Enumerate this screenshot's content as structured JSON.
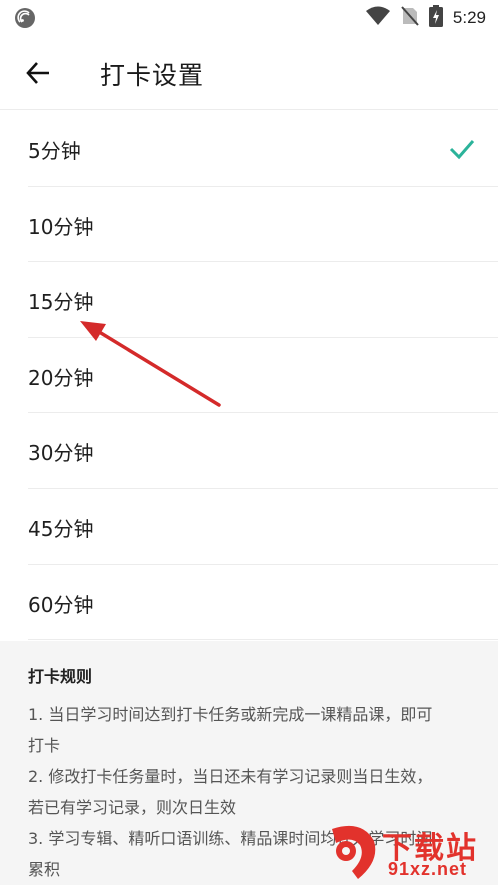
{
  "status_bar": {
    "time": "5:29"
  },
  "header": {
    "title": "打卡设置"
  },
  "options": [
    {
      "label": "5分钟",
      "selected": true
    },
    {
      "label": "10分钟",
      "selected": false
    },
    {
      "label": "15分钟",
      "selected": false
    },
    {
      "label": "20分钟",
      "selected": false
    },
    {
      "label": "30分钟",
      "selected": false
    },
    {
      "label": "45分钟",
      "selected": false
    },
    {
      "label": "60分钟",
      "selected": false
    }
  ],
  "rules": {
    "title": "打卡规则",
    "lines": [
      "1. 当日学习时间达到打卡任务或新完成一课精品课，即可",
      "打卡",
      "2. 修改打卡任务量时，当日还未有学习记录则当日生效，",
      "若已有学习记录，则次日生效",
      "3. 学习专辑、精听口语训练、精品课时间均计入学习时间",
      "累积"
    ]
  },
  "watermark": {
    "text_top": "下载站",
    "text_bottom": "91xz.net"
  },
  "colors": {
    "accent": "#2bb39a",
    "annotation_arrow": "#d42a2a",
    "rules_bg": "#f5f5f5"
  }
}
